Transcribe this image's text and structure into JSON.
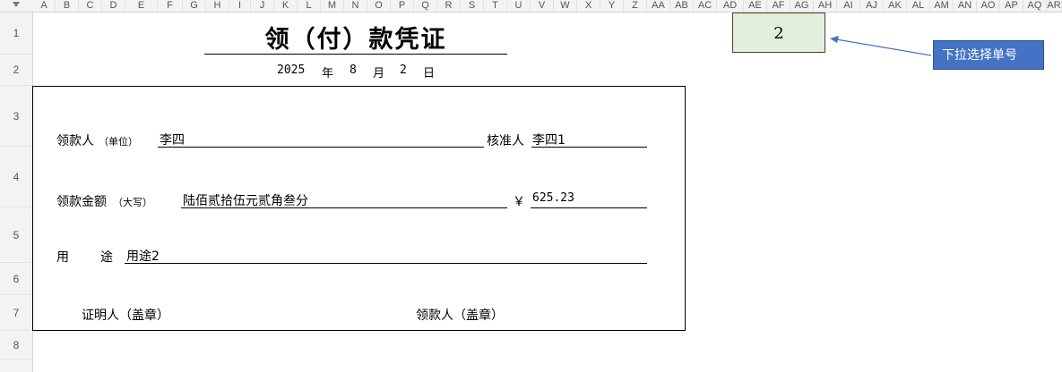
{
  "columns": [
    "A",
    "B",
    "C",
    "D",
    "E",
    "F",
    "G",
    "H",
    "I",
    "J",
    "K",
    "L",
    "M",
    "N",
    "O",
    "P",
    "Q",
    "R",
    "S",
    "T",
    "U",
    "V",
    "W",
    "X",
    "Y",
    "Z",
    "AA",
    "AB",
    "AC",
    "AD",
    "AE",
    "AF",
    "AG",
    "AH",
    "AI",
    "AJ",
    "AK",
    "AL",
    "AM",
    "AN",
    "AO",
    "AP",
    "AQ",
    "AR"
  ],
  "rows": [
    "1",
    "2",
    "3",
    "4",
    "5",
    "6",
    "7",
    "8"
  ],
  "sheet": {
    "title": "领（付）款凭证",
    "date": {
      "year": "2025",
      "year_unit": "年",
      "month": "8",
      "month_unit": "月",
      "day": "2",
      "day_unit": "日"
    },
    "selector_value": "2",
    "callout": "下拉选择单号"
  },
  "voucher": {
    "payee_label": "领款人",
    "payee_hint": "（单位）",
    "payee_value": "李四",
    "approver_label": "核准人",
    "approver_value": "李四1",
    "amount_label": "领款金额",
    "amount_hint": "（大写）",
    "amount_text": "陆佰贰拾伍元贰角叁分",
    "currency_symbol": "￥",
    "amount_number": "625.23",
    "purpose_label_1": "用",
    "purpose_label_2": "途",
    "purpose_value": "用途2",
    "witness_label": "证明人（盖章）",
    "receiver_label": "领款人（盖章）"
  },
  "colors": {
    "selector_fill": "#e2efda",
    "callout_fill": "#4472c4",
    "arrow": "#4472c4"
  }
}
